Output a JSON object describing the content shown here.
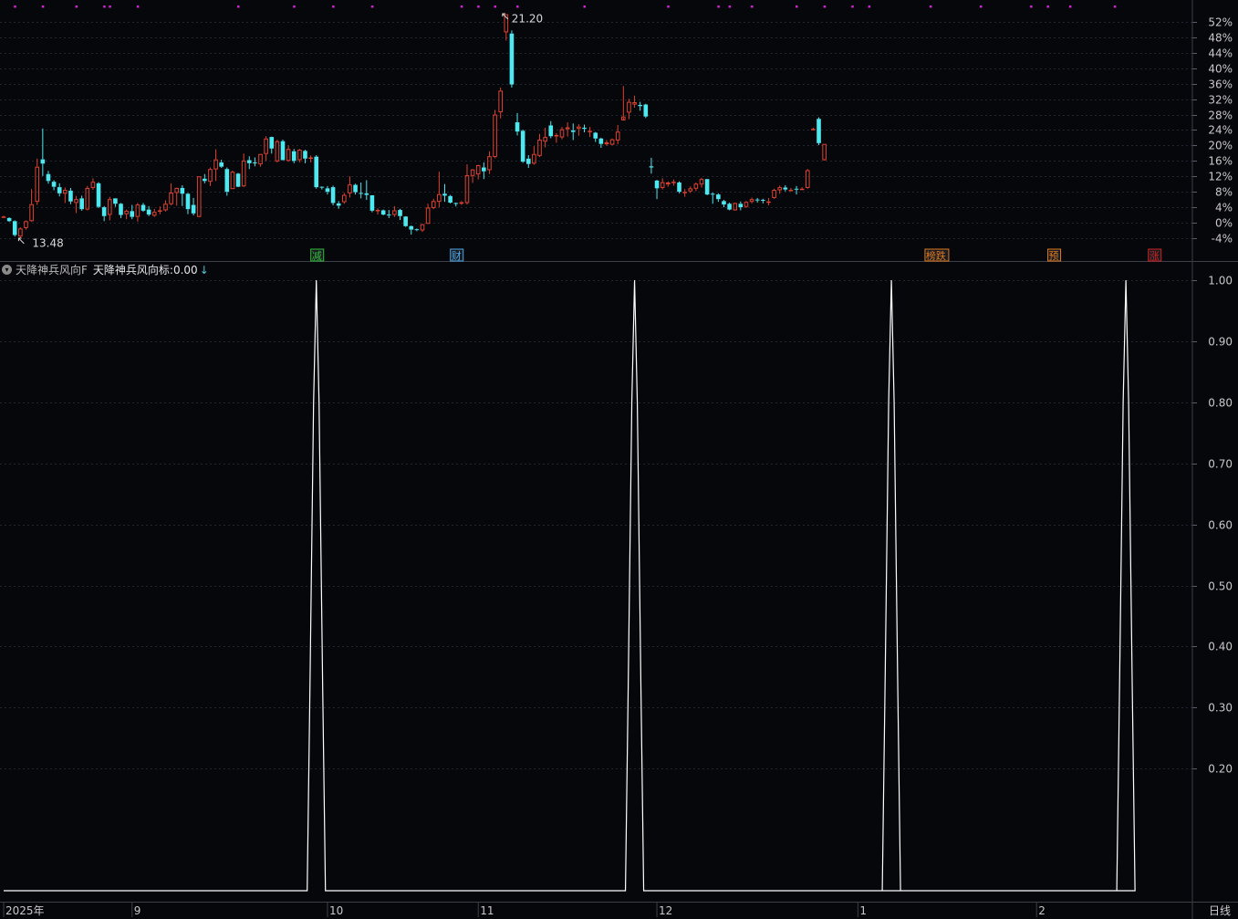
{
  "colors": {
    "background": "#06070b",
    "up": "#e0422f",
    "down": "#4ee8f0",
    "grid": "#222630",
    "axis_text": "#c8c8c8",
    "indicator_line": "#ffffff",
    "marker_dot": "#d61fd6"
  },
  "indicator": {
    "name": "天降神兵风向F",
    "line_name": "天降神兵风向标",
    "separator": ": ",
    "value": "0.00",
    "arrow": "↓"
  },
  "period_label": "日线",
  "chart_data": [
    {
      "type": "candlestick",
      "y_axis_ticks": [
        "52%",
        "48%",
        "44%",
        "40%",
        "36%",
        "32%",
        "28%",
        "24%",
        "20%",
        "16%",
        "12%",
        "8%",
        "4%",
        "0%",
        "-4%"
      ],
      "ylim_percent": [
        -6,
        54
      ],
      "annotations": {
        "high_label": "21.20",
        "low_label": "13.48"
      },
      "event_tags": [
        {
          "index": 56,
          "text": "减",
          "color": "#2fbf3a"
        },
        {
          "index": 81,
          "text": "财",
          "color": "#4aa8e8"
        },
        {
          "index": 166,
          "text": "榜跌",
          "color": "#e07a1c"
        },
        {
          "index": 188,
          "text": "预",
          "color": "#e07a1c"
        },
        {
          "index": 206,
          "text": "涨",
          "color": "#d02020"
        }
      ],
      "candles": [
        [
          1.6,
          1.6,
          1.2,
          1.8
        ],
        [
          1.2,
          0.4,
          0.2,
          1.4
        ],
        [
          0.4,
          -3.2,
          -3.6,
          0.6
        ],
        [
          -3.6,
          -1.5,
          -3.9,
          -1.2
        ],
        [
          -1.4,
          0.4,
          -1.8,
          0.6
        ],
        [
          0.4,
          4.8,
          0.2,
          8.7
        ],
        [
          5.4,
          14.5,
          4.6,
          16.6
        ],
        [
          16.4,
          15.3,
          12.1,
          24.4
        ],
        [
          12.6,
          10.8,
          10.1,
          13.4
        ],
        [
          10.6,
          9.3,
          8.4,
          11.0
        ],
        [
          9.2,
          7.6,
          6.8,
          10.2
        ],
        [
          7.5,
          8.5,
          5.1,
          9.1
        ],
        [
          8.3,
          5.5,
          4.8,
          9.0
        ],
        [
          5.1,
          6.1,
          2.5,
          6.9
        ],
        [
          6.3,
          3.5,
          3.1,
          7.0
        ],
        [
          3.4,
          9.0,
          3.2,
          9.5
        ],
        [
          9.0,
          10.6,
          8.5,
          11.5
        ],
        [
          10.2,
          4.1,
          3.8,
          10.5
        ],
        [
          4.0,
          1.7,
          0.4,
          4.3
        ],
        [
          2.0,
          6.1,
          0.6,
          6.7
        ],
        [
          6.3,
          4.9,
          4.1,
          6.3
        ],
        [
          4.9,
          2.0,
          1.2,
          5.1
        ],
        [
          2.2,
          3.1,
          0.9,
          3.4
        ],
        [
          3.0,
          1.5,
          0.9,
          4.6
        ],
        [
          1.5,
          4.7,
          0.3,
          5.1
        ],
        [
          4.6,
          3.1,
          2.8,
          5.1
        ],
        [
          3.4,
          2.1,
          1.7,
          4.3
        ],
        [
          1.8,
          2.8,
          1.5,
          3.6
        ],
        [
          2.9,
          3.2,
          2.2,
          4.2
        ],
        [
          3.2,
          4.9,
          2.9,
          5.8
        ],
        [
          4.8,
          7.8,
          4.5,
          10.2
        ],
        [
          7.7,
          9.0,
          4.4,
          9.1
        ],
        [
          9.0,
          7.5,
          4.3,
          9.7
        ],
        [
          7.5,
          3.5,
          2.2,
          7.7
        ],
        [
          4.6,
          2.4,
          1.9,
          6.4
        ],
        [
          1.5,
          12.0,
          1.4,
          12.0
        ],
        [
          11.4,
          10.8,
          10.2,
          12.6
        ],
        [
          10.6,
          13.9,
          9.5,
          14.3
        ],
        [
          13.8,
          16.4,
          10.8,
          19.0
        ],
        [
          15.6,
          14.5,
          14.2,
          16.3
        ],
        [
          13.9,
          8.0,
          7.0,
          14.3
        ],
        [
          8.7,
          13.2,
          8.7,
          13.5
        ],
        [
          12.7,
          9.3,
          9.2,
          12.9
        ],
        [
          9.4,
          16.1,
          9.2,
          17.9
        ],
        [
          16.2,
          15.4,
          13.9,
          17.2
        ],
        [
          15.6,
          15.5,
          14.6,
          16.9
        ],
        [
          15.1,
          17.8,
          14.5,
          17.8
        ],
        [
          17.8,
          21.8,
          16.0,
          22.4
        ],
        [
          22.2,
          19.2,
          17.9,
          22.3
        ],
        [
          15.9,
          21.1,
          15.6,
          21.5
        ],
        [
          21.1,
          16.2,
          16.5,
          21.5
        ],
        [
          16.0,
          19.1,
          15.8,
          20.0
        ],
        [
          18.5,
          16.0,
          15.4,
          19.1
        ],
        [
          16.2,
          18.9,
          15.6,
          19.1
        ],
        [
          18.6,
          16.6,
          15.4,
          18.9
        ],
        [
          16.7,
          16.9,
          15.6,
          17.4
        ],
        [
          17.1,
          9.2,
          8.8,
          17.5
        ],
        [
          9.3,
          9.1,
          8.6,
          9.4
        ],
        [
          8.9,
          8.0,
          7.3,
          9.5
        ],
        [
          9.2,
          5.1,
          4.5,
          9.6
        ],
        [
          5.0,
          4.4,
          3.6,
          5.6
        ],
        [
          5.3,
          7.2,
          4.9,
          7.7
        ],
        [
          7.6,
          9.9,
          6.5,
          12.0
        ],
        [
          9.8,
          7.9,
          7.3,
          10.1
        ],
        [
          7.7,
          7.6,
          6.3,
          10.4
        ],
        [
          7.6,
          7.2,
          5.9,
          11.0
        ],
        [
          7.1,
          3.1,
          2.7,
          7.1
        ],
        [
          3.0,
          3.3,
          2.1,
          3.7
        ],
        [
          3.2,
          2.1,
          1.9,
          3.4
        ],
        [
          2.1,
          2.0,
          1.2,
          3.3
        ],
        [
          2.0,
          3.2,
          1.5,
          4.3
        ],
        [
          3.3,
          1.7,
          0.7,
          3.6
        ],
        [
          1.6,
          -0.9,
          -1.1,
          1.7
        ],
        [
          -0.9,
          -1.8,
          -3.1,
          -0.7
        ],
        [
          -1.7,
          -1.8,
          -2.2,
          -1.5
        ],
        [
          -2.0,
          -0.4,
          -2.4,
          -0.3
        ],
        [
          -0.3,
          3.9,
          -0.3,
          4.9
        ],
        [
          3.8,
          5.6,
          3.5,
          6.2
        ],
        [
          5.4,
          7.4,
          4.0,
          13.2
        ],
        [
          7.5,
          7.0,
          5.4,
          10.0
        ],
        [
          6.9,
          5.2,
          5.0,
          7.2
        ],
        [
          5.1,
          5.0,
          4.2,
          5.2
        ],
        [
          4.9,
          5.3,
          4.6,
          5.6
        ],
        [
          5.1,
          12.3,
          4.7,
          15.1
        ],
        [
          12.1,
          13.8,
          10.3,
          13.9
        ],
        [
          12.5,
          14.9,
          11.2,
          15.0
        ],
        [
          14.3,
          13.3,
          11.3,
          15.6
        ],
        [
          13.6,
          17.2,
          12.6,
          18.5
        ],
        [
          17.0,
          28.0,
          16.7,
          29.2
        ],
        [
          28.6,
          34.2,
          27.0,
          35.0
        ],
        [
          49.3,
          54.0,
          47.2,
          54.0
        ],
        [
          49.0,
          35.8,
          35.0,
          49.8
        ],
        [
          26.0,
          23.6,
          22.6,
          28.4
        ],
        [
          23.8,
          15.8,
          15.5,
          24.1
        ],
        [
          16.6,
          15.2,
          14.2,
          17.5
        ],
        [
          15.3,
          17.8,
          15.0,
          19.8
        ],
        [
          17.3,
          21.5,
          17.0,
          23.0
        ],
        [
          21.0,
          22.2,
          19.5,
          24.6
        ],
        [
          25.2,
          22.4,
          21.9,
          26.3
        ],
        [
          22.4,
          22.7,
          20.7,
          23.2
        ],
        [
          22.1,
          24.2,
          21.6,
          24.8
        ],
        [
          24.2,
          24.7,
          22.3,
          26.0
        ],
        [
          23.9,
          23.5,
          21.4,
          25.7
        ],
        [
          24.3,
          24.9,
          22.5,
          25.5
        ],
        [
          24.6,
          24.3,
          23.4,
          25.4
        ],
        [
          23.8,
          23.8,
          22.2,
          24.8
        ],
        [
          23.3,
          21.8,
          20.9,
          23.5
        ],
        [
          21.8,
          20.4,
          19.4,
          22.0
        ],
        [
          20.3,
          20.8,
          19.9,
          21.4
        ],
        [
          20.2,
          21.6,
          20.1,
          21.8
        ],
        [
          21.3,
          23.6,
          20.3,
          25.3
        ],
        [
          26.5,
          27.5,
          27.2,
          35.4
        ],
        [
          28.5,
          31.3,
          26.8,
          32.1
        ],
        [
          30.6,
          31.2,
          29.8,
          32.9
        ],
        [
          30.5,
          30.2,
          29.0,
          31.3
        ],
        [
          30.6,
          27.5,
          27.1,
          30.8
        ],
        [
          14.6,
          14.3,
          12.7,
          16.8
        ],
        [
          10.9,
          8.9,
          6.1,
          11.1
        ],
        [
          9.0,
          10.5,
          8.6,
          11.5
        ],
        [
          9.9,
          10.4,
          9.3,
          10.7
        ],
        [
          10.4,
          10.6,
          9.6,
          11.2
        ],
        [
          10.4,
          8.0,
          7.6,
          10.7
        ],
        [
          8.0,
          8.0,
          6.7,
          8.7
        ],
        [
          8.1,
          8.9,
          7.7,
          9.4
        ],
        [
          8.8,
          10.1,
          8.2,
          10.4
        ],
        [
          9.9,
          11.3,
          9.1,
          11.6
        ],
        [
          11.3,
          7.3,
          7.1,
          11.3
        ],
        [
          7.5,
          7.3,
          4.9,
          7.8
        ],
        [
          7.3,
          6.1,
          5.4,
          7.6
        ],
        [
          5.6,
          4.7,
          4.0,
          5.9
        ],
        [
          4.9,
          3.4,
          3.2,
          5.2
        ],
        [
          3.2,
          5.1,
          3.1,
          5.2
        ],
        [
          4.9,
          4.0,
          3.2,
          5.5
        ],
        [
          4.1,
          5.4,
          3.8,
          5.6
        ],
        [
          5.4,
          6.1,
          5.0,
          6.5
        ],
        [
          6.0,
          5.8,
          5.2,
          6.4
        ],
        [
          5.9,
          5.7,
          5.0,
          6.2
        ],
        [
          5.5,
          5.5,
          4.5,
          6.4
        ],
        [
          6.4,
          8.5,
          6.2,
          8.8
        ],
        [
          8.4,
          9.2,
          7.5,
          9.6
        ],
        [
          9.1,
          8.6,
          8.1,
          9.7
        ],
        [
          8.5,
          8.5,
          8.2,
          9.0
        ],
        [
          8.8,
          8.6,
          7.3,
          9.5
        ],
        [
          8.6,
          8.8,
          8.5,
          9.2
        ],
        [
          9.0,
          13.6,
          8.8,
          13.9
        ],
        [
          24.3,
          24.3,
          24.1,
          24.6
        ],
        [
          26.9,
          20.6,
          20.1,
          27.3
        ],
        [
          16.2,
          20.4,
          16.1,
          20.4
        ]
      ]
    },
    {
      "type": "line",
      "name": "天降神兵风向标",
      "y_axis_ticks": [
        "1.00",
        "0.90",
        "0.80",
        "0.70",
        "0.60",
        "0.50",
        "0.40",
        "0.30",
        "0.20"
      ],
      "ylim": [
        0,
        1
      ],
      "baseline": 0,
      "spikes": [
        {
          "index": 56,
          "value": 1.0
        },
        {
          "index": 113,
          "value": 1.0
        },
        {
          "index": 159,
          "value": 1.0
        },
        {
          "index": 201,
          "value": 1.0
        }
      ]
    }
  ],
  "x_axis_labels": [
    {
      "index": 0,
      "text": "2025年"
    },
    {
      "index": 23,
      "text": "9"
    },
    {
      "index": 58,
      "text": "10"
    },
    {
      "index": 85,
      "text": "11"
    },
    {
      "index": 117,
      "text": "12"
    },
    {
      "index": 153,
      "text": "1"
    },
    {
      "index": 185,
      "text": "2"
    }
  ],
  "marker_dots_indices": [
    2,
    7,
    13,
    18,
    19,
    24,
    42,
    52,
    59,
    66,
    82,
    85,
    88,
    92,
    104,
    119,
    128,
    130,
    134,
    142,
    147,
    152,
    155,
    166,
    175,
    184,
    187,
    191,
    199
  ]
}
